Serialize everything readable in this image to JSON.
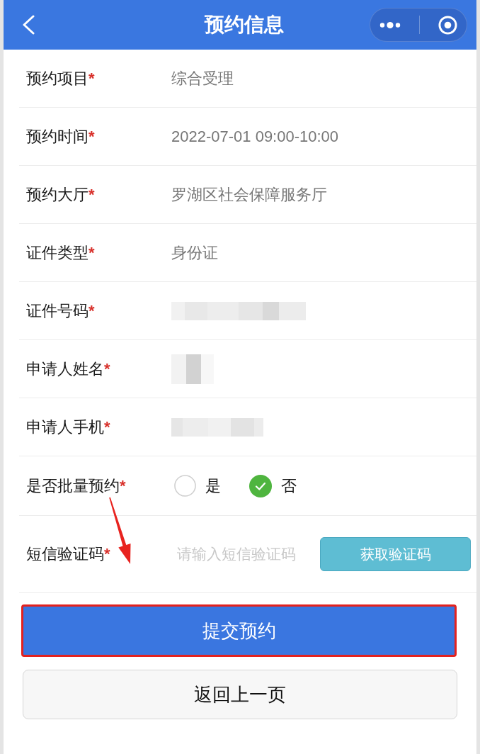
{
  "header": {
    "title": "预约信息"
  },
  "form": [
    {
      "kind": "text",
      "label": "预约项目",
      "required_mark": "*",
      "value": "综合受理"
    },
    {
      "kind": "text",
      "label": "预约时间",
      "required_mark": "*",
      "value": "2022-07-01 09:00-10:00"
    },
    {
      "kind": "text",
      "label": "预约大厅",
      "required_mark": "*",
      "value": "罗湖区社会保障服务厅"
    },
    {
      "kind": "text",
      "label": "证件类型",
      "required_mark": "*",
      "value": "身份证"
    },
    {
      "kind": "redacted",
      "label": "证件号码",
      "required_mark": "*"
    },
    {
      "kind": "redacted",
      "label": "申请人姓名",
      "required_mark": "*"
    },
    {
      "kind": "redacted",
      "label": "申请人手机",
      "required_mark": "*"
    },
    {
      "kind": "radio",
      "label": "是否批量预约",
      "required_mark": "*",
      "options": [
        {
          "label": "是",
          "selected": false
        },
        {
          "label": "否",
          "selected": true
        }
      ]
    },
    {
      "kind": "code",
      "label": "短信验证码",
      "required_mark": "*",
      "placeholder": "请输入短信验证码",
      "button": "获取验证码"
    }
  ],
  "buttons": [
    {
      "kind": "primary",
      "label": "提交预约",
      "highlighted": true
    },
    {
      "kind": "secondary",
      "label": "返回上一页",
      "highlighted": false
    }
  ],
  "annotations": [
    {
      "kind": "arrow"
    }
  ]
}
